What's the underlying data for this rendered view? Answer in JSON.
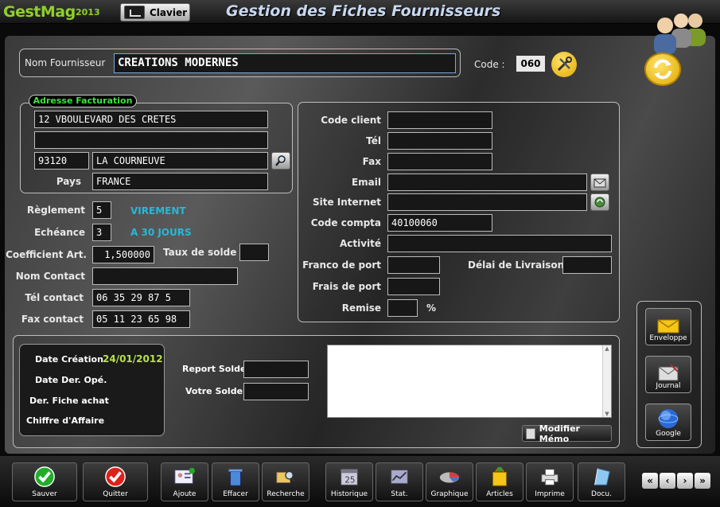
{
  "app": {
    "brand": "GestMag",
    "year": "2013",
    "keyboard_label": "Clavier",
    "window_title": "Gestion des Fiches Fournisseurs"
  },
  "header": {
    "supplier_name_label": "Nom Fournisseur",
    "supplier_name": "CREATIONS MODERNES",
    "code_label": "Code :",
    "code": "060"
  },
  "billing": {
    "legend": "Adresse Facturation",
    "address1": "12 VBOULEVARD DES CRETES",
    "address2": "",
    "postal_code": "93120",
    "city": "LA COURNEUVE",
    "country_label": "Pays",
    "country": "FRANCE"
  },
  "terms": {
    "payment_label": "Règlement",
    "payment_code": "5",
    "payment_text": "VIREMENT",
    "due_label": "Echéance",
    "due_code": "3",
    "due_text": "A 30 JOURS",
    "coef_label": "Coefficient Art.",
    "coef": "1,500000",
    "sale_rate_label": "Taux de solde",
    "sale_rate": "",
    "contact_label": "Nom Contact",
    "contact": "",
    "contact_phone_label": "Tél contact",
    "contact_phone": "06 35 29 87 5",
    "contact_fax_label": "Fax contact",
    "contact_fax": "05 11 23 65 98"
  },
  "info": {
    "client_code_label": "Code client",
    "client_code": "",
    "phone_label": "Tél",
    "phone": "",
    "fax_label": "Fax",
    "fax": "",
    "email_label": "Email",
    "email": "",
    "website_label": "Site Internet",
    "website": "",
    "account_label": "Code compta",
    "account": "40100060",
    "activity_label": "Activité",
    "activity": "",
    "free_shipping_label": "Franco de port",
    "free_shipping": "",
    "delivery_label": "Délai de Livraison",
    "delivery": "",
    "shipping_label": "Frais de port",
    "shipping": "",
    "discount_label": "Remise",
    "discount": "",
    "percent": "%"
  },
  "stats": {
    "created_label": "Date Création",
    "created": "24/01/2012",
    "last_op_label": "Date Der. Opé.",
    "last_purchase_label": "Der. Fiche achat",
    "turnover_label": "Chiffre d'Affaire",
    "carry_label": "Report Solde",
    "carry": "",
    "balance_label": "Votre Solde",
    "balance": ""
  },
  "memo": {
    "text": "",
    "edit_label": "Modifier Mémo"
  },
  "side_buttons": [
    {
      "label": "Enveloppe",
      "icon": "envelope-icon"
    },
    {
      "label": "Journal",
      "icon": "journal-icon"
    },
    {
      "label": "Google",
      "icon": "globe-icon"
    }
  ],
  "toolbar": {
    "save": "Sauver",
    "quit": "Quitter",
    "add": "Ajoute",
    "delete": "Effacer",
    "search": "Recherche",
    "history": "Historique",
    "stat": "Stat.",
    "graph": "Graphique",
    "articles": "Articles",
    "print": "Imprime",
    "docs": "Docu."
  },
  "nav": [
    "«",
    "‹",
    "›",
    "»"
  ],
  "colors": {
    "accent_green": "#8fd02a",
    "cyan": "#27b8d8",
    "date_green": "#b8e04a"
  }
}
